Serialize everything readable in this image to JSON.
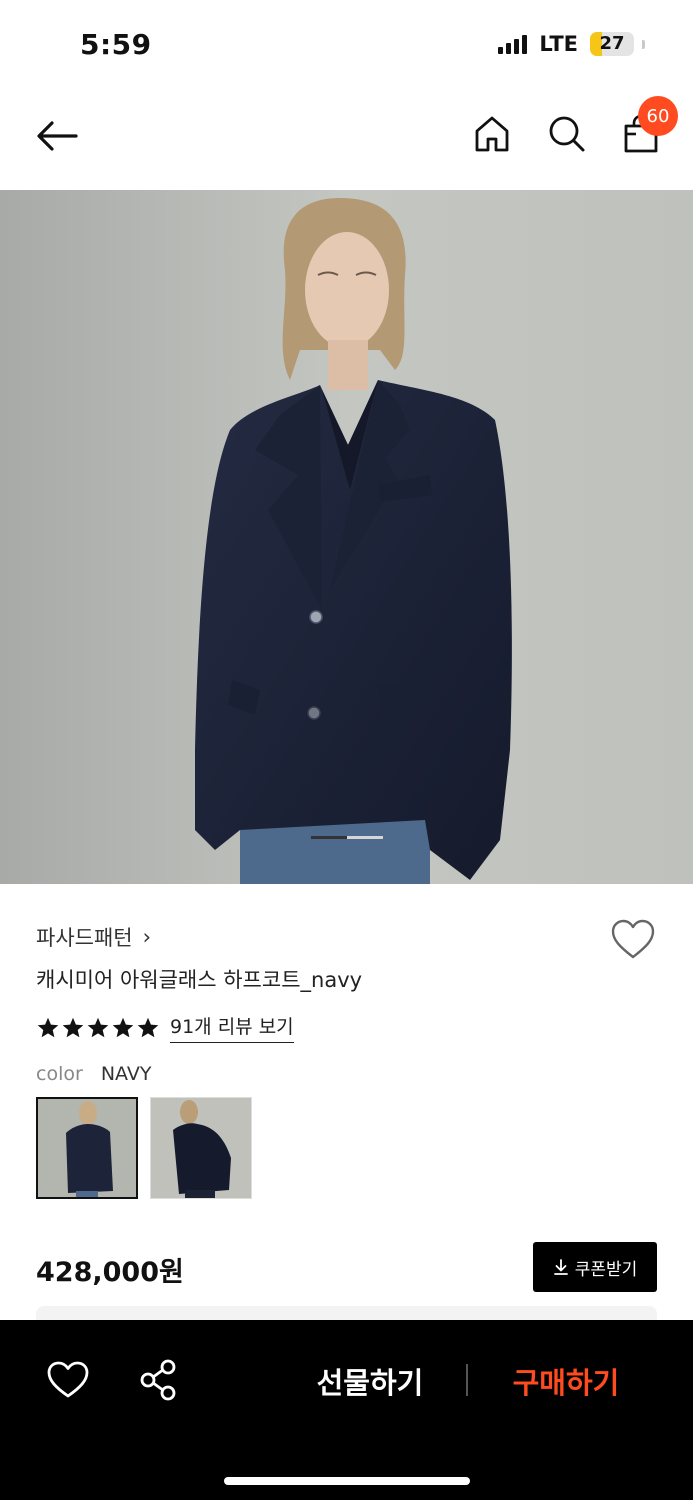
{
  "status_bar": {
    "time": "5:59",
    "network": "LTE",
    "battery": "27",
    "battery_level": 0.27
  },
  "header": {
    "cart_count": "60",
    "icons": [
      "back-arrow-icon",
      "home-icon",
      "search-icon",
      "shopping-bag-icon"
    ]
  },
  "hero": {
    "slide_index": 1,
    "slide_count": 2
  },
  "product": {
    "brand": "파사드패턴",
    "brand_chevron": "›",
    "name": "캐시미어 아워글래스 하프코트_navy",
    "rating": 5,
    "review_link": "91개 리뷰 보기",
    "color_label": "color",
    "color_value": "NAVY",
    "price": "428,000원",
    "coupon_button": "쿠폰받기"
  },
  "bottom_bar": {
    "gift_label": "선물하기",
    "buy_label": "구매하기"
  },
  "colors": {
    "accent": "#ff4b1f",
    "navy": "#1b2238",
    "bar": "#000000"
  }
}
